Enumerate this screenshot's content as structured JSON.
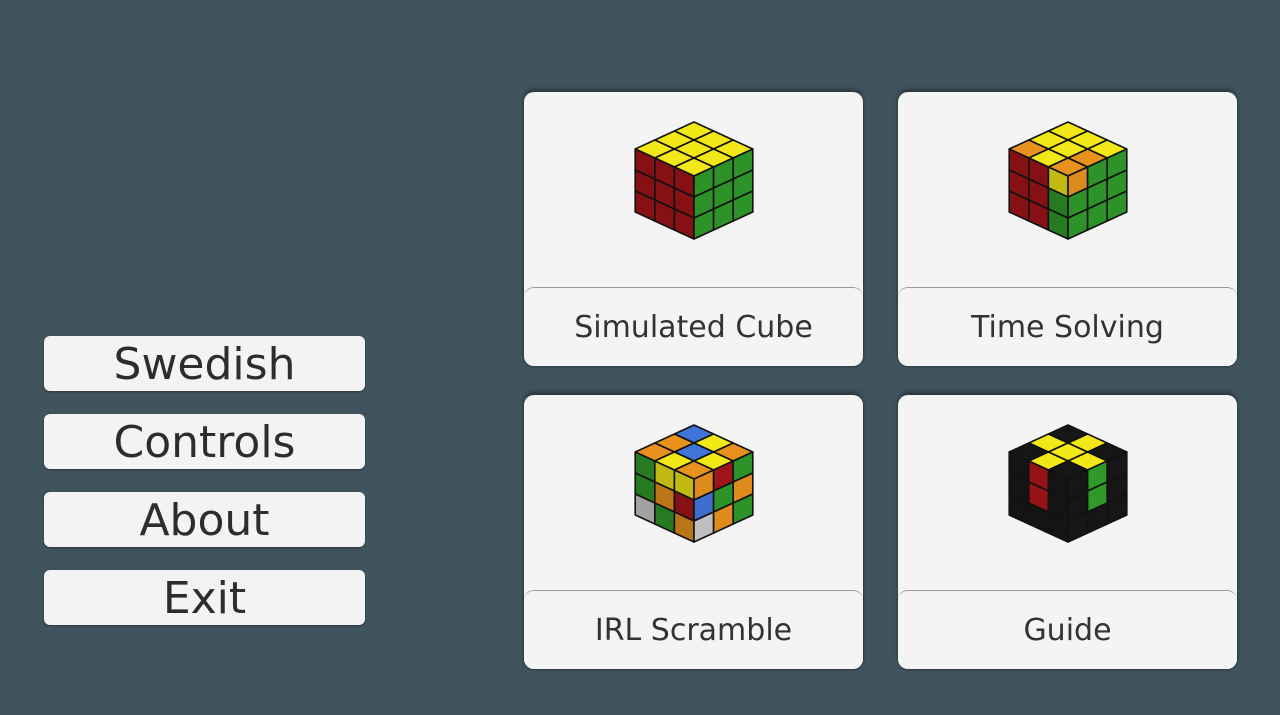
{
  "menu": {
    "items": [
      {
        "label": "Swedish"
      },
      {
        "label": "Controls"
      },
      {
        "label": "About"
      },
      {
        "label": "Exit"
      }
    ]
  },
  "modes": [
    {
      "label": "Simulated Cube",
      "icon": "solved-cube-icon"
    },
    {
      "label": "Time Solving",
      "icon": "partially-turned-cube-icon"
    },
    {
      "label": "IRL Scramble",
      "icon": "scrambled-cube-icon"
    },
    {
      "label": "Guide",
      "icon": "guide-cross-cube-icon"
    }
  ],
  "colors": {
    "background": "#40545d",
    "button": "#f3f3f3",
    "yellow": "#f3e817",
    "red": "#a7151a",
    "green": "#2f9a2a",
    "orange": "#e8921d",
    "blue": "#3f74d8",
    "white": "#c9c9c9",
    "black": "#161616"
  }
}
